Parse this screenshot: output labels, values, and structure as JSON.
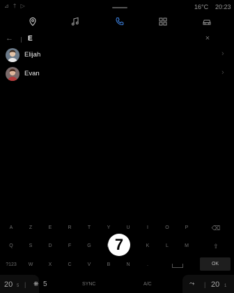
{
  "status": {
    "left_icons": "⊿ † ▷",
    "temperature": "16°C",
    "time": "20:23"
  },
  "nav": {
    "items": [
      {
        "name": "navigation",
        "icon": "location-pin-icon"
      },
      {
        "name": "music",
        "icon": "music-note-icon"
      },
      {
        "name": "phone",
        "icon": "phone-icon",
        "active": true
      },
      {
        "name": "apps",
        "icon": "grid-icon"
      },
      {
        "name": "vehicle",
        "icon": "car-icon"
      }
    ]
  },
  "search": {
    "back_icon": "←",
    "query": "E",
    "clear_icon": "×"
  },
  "contacts": [
    {
      "name": "Elijah",
      "chevron": "›"
    },
    {
      "name": "Evan",
      "chevron": "›"
    }
  ],
  "keyboard": {
    "row1": [
      "A",
      "Z",
      "E",
      "R",
      "T",
      "Y",
      "U",
      "I",
      "O",
      "P",
      "⌫"
    ],
    "row2": [
      "Q",
      "S",
      "D",
      "F",
      "G",
      "H",
      "J",
      "K",
      "L",
      "M",
      "⇧"
    ],
    "row3": [
      "?123",
      "W",
      "X",
      "C",
      "V",
      "B",
      "N",
      "."
    ],
    "ok_label": "OK"
  },
  "callout": "7",
  "climate": {
    "left_temp": "20",
    "left_temp_sub": "5",
    "fan_icon": "❋",
    "fan_level": "5",
    "sync_label": "SYNC",
    "ac_label": "A/C",
    "seat_icon": "⤳",
    "right_temp": "20",
    "right_temp_sub": "1"
  }
}
